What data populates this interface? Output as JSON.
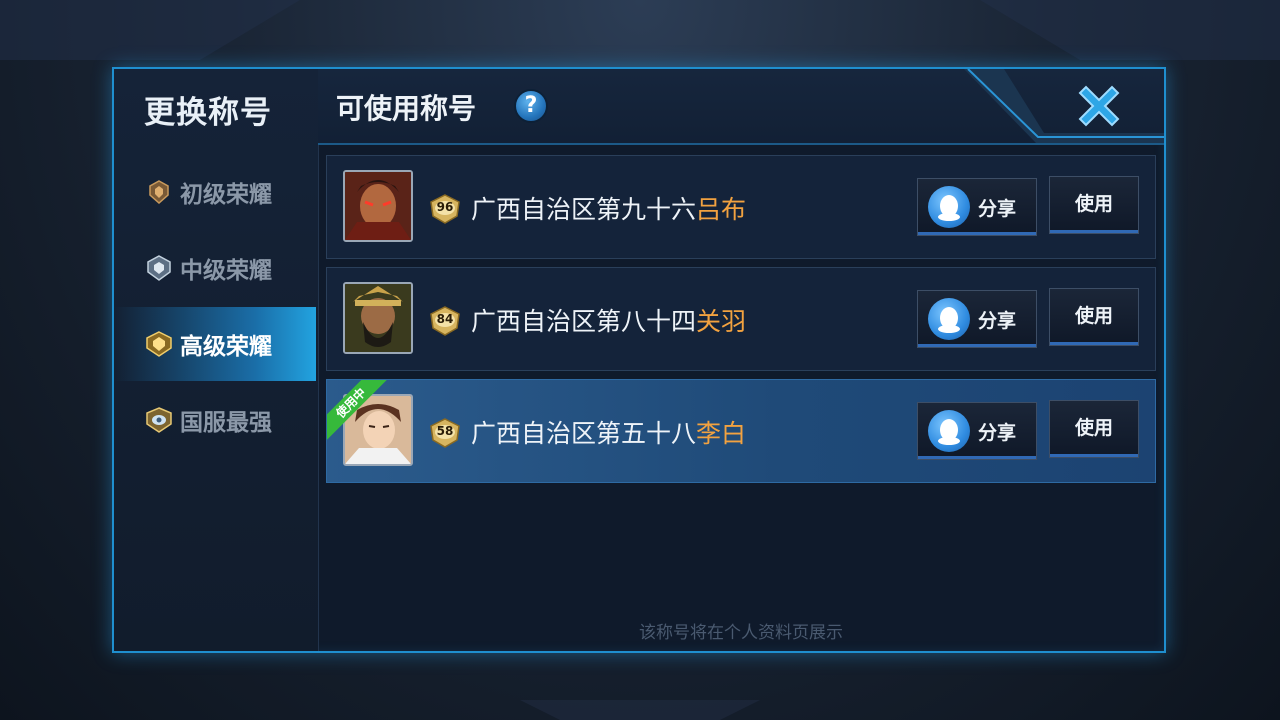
{
  "sidebar": {
    "title": "更换称号",
    "items": [
      {
        "label": "初级荣耀",
        "active": false
      },
      {
        "label": "中级荣耀",
        "active": false
      },
      {
        "label": "高级荣耀",
        "active": true
      },
      {
        "label": "国服最强",
        "active": false
      }
    ]
  },
  "header": {
    "title": "可使用称号",
    "help": "?"
  },
  "titles": [
    {
      "prefix": "广西自治区第九十六",
      "hero": "吕布",
      "level": "96",
      "share_label": "分享",
      "use_label": "使用",
      "in_use": false
    },
    {
      "prefix": "广西自治区第八十四",
      "hero": "关羽",
      "level": "84",
      "share_label": "分享",
      "use_label": "使用",
      "in_use": false
    },
    {
      "prefix": "广西自治区第五十八",
      "hero": "李白",
      "level": "58",
      "share_label": "分享",
      "use_label": "使用",
      "in_use": true,
      "in_use_label": "使用中"
    }
  ],
  "footer_note": "该称号将在个人资料页展示",
  "colors": {
    "accent": "#1f8fcf",
    "hero_name": "#f2a240",
    "in_use_ribbon": "#36b93b"
  }
}
